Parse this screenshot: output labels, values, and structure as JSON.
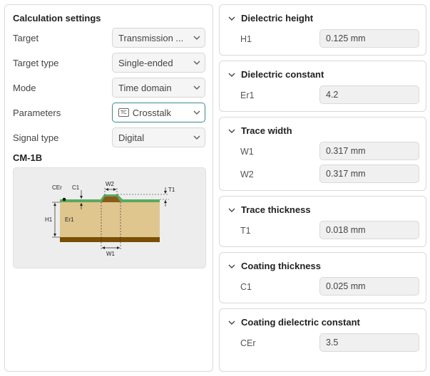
{
  "settings": {
    "title": "Calculation settings",
    "rows": [
      {
        "label": "Target",
        "value": "Transmission ..."
      },
      {
        "label": "Target type",
        "value": "Single-ended"
      },
      {
        "label": "Mode",
        "value": "Time domain"
      },
      {
        "label": "Parameters",
        "value": "Crosstalk",
        "badge": "TC"
      },
      {
        "label": "Signal type",
        "value": "Digital"
      }
    ]
  },
  "model": {
    "name": "CM-1B",
    "labels": {
      "cer": "CEr",
      "c1": "C1",
      "w2": "W2",
      "t1": "T1",
      "h1": "H1",
      "er1": "Er1",
      "w1": "W1"
    },
    "colors": {
      "substrate": "#dfc68e",
      "ground": "#7a4f05",
      "coating": "#5aaa5e",
      "trace": "#8a5a1a"
    }
  },
  "params": {
    "dielectric_height": {
      "title": "Dielectric height",
      "label": "H1",
      "value": "0.125 mm"
    },
    "dielectric_constant": {
      "title": "Dielectric constant",
      "label": "Er1",
      "value": "4.2"
    },
    "trace_width": {
      "title": "Trace width",
      "w1_label": "W1",
      "w1_value": "0.317 mm",
      "w2_label": "W2",
      "w2_value": "0.317 mm"
    },
    "trace_thickness": {
      "title": "Trace thickness",
      "label": "T1",
      "value": "0.018 mm"
    },
    "coating_thickness": {
      "title": "Coating thickness",
      "label": "C1",
      "value": "0.025 mm"
    },
    "coating_dielectric_constant": {
      "title": "Coating dielectric constant",
      "label": "CEr",
      "value": "3.5"
    }
  },
  "icons": {
    "expand": "chevron-down-icon",
    "collapse": "chevron-down-icon"
  }
}
